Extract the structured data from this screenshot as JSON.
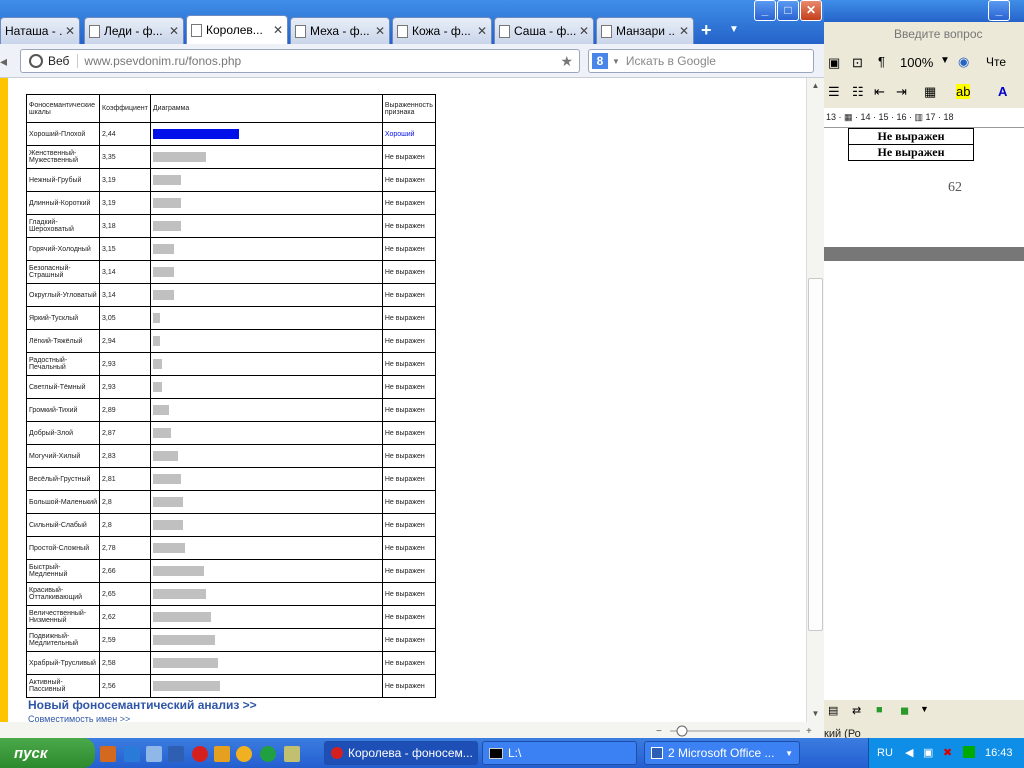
{
  "browser": {
    "tabs": [
      {
        "label": "Наташа - ..."
      },
      {
        "label": "Леди - ф..."
      },
      {
        "label": "Королев..."
      },
      {
        "label": "Меха - ф..."
      },
      {
        "label": "Кожа - ф..."
      },
      {
        "label": "Саша - ф..."
      },
      {
        "label": "Манзари ..."
      }
    ],
    "newtab": "+",
    "tab_close": "✕",
    "address": {
      "web_label": "Веб",
      "url": "www.psevdonim.ru/fonos.php"
    },
    "search": {
      "placeholder": "Искать в Google",
      "engine": "8"
    }
  },
  "table": {
    "headers": [
      "Фоносемантические шкалы",
      "Коэффициент",
      "Диаграмма",
      "Выраженность признака"
    ],
    "rows": [
      {
        "scale": "Хороший-Плохой",
        "coef": "2,44",
        "level": 0.37,
        "status": "Хороший",
        "highlight": true
      },
      {
        "scale": "Женственный-Мужественный",
        "coef": "3,35",
        "level": 0.23,
        "status": "Не выражен"
      },
      {
        "scale": "Нежный-Грубый",
        "coef": "3,19",
        "level": 0.12,
        "status": "Не выражен"
      },
      {
        "scale": "Длинный-Короткий",
        "coef": "3,19",
        "level": 0.12,
        "status": "Не выражен"
      },
      {
        "scale": "Гладкий-Шероховатый",
        "coef": "3,18",
        "level": 0.12,
        "status": "Не выражен"
      },
      {
        "scale": "Горячий-Холодный",
        "coef": "3,15",
        "level": 0.09,
        "status": "Не выражен"
      },
      {
        "scale": "Безопасный-Страшный",
        "coef": "3,14",
        "level": 0.09,
        "status": "Не выражен"
      },
      {
        "scale": "Округлый-Угловатый",
        "coef": "3,14",
        "level": 0.09,
        "status": "Не выражен"
      },
      {
        "scale": "Яркий-Тусклый",
        "coef": "3,05",
        "level": 0.03,
        "status": "Не выражен"
      },
      {
        "scale": "Лёгкий-Тяжёлый",
        "coef": "2,94",
        "level": 0.03,
        "status": "Не выражен"
      },
      {
        "scale": "Радостный-Печальный",
        "coef": "2,93",
        "level": 0.04,
        "status": "Не выражен"
      },
      {
        "scale": "Светлый-Тёмный",
        "coef": "2,93",
        "level": 0.04,
        "status": "Не выражен"
      },
      {
        "scale": "Громкий-Тихий",
        "coef": "2,89",
        "level": 0.07,
        "status": "Не выражен"
      },
      {
        "scale": "Добрый-Злой",
        "coef": "2,87",
        "level": 0.08,
        "status": "Не выражен"
      },
      {
        "scale": "Могучий-Хилый",
        "coef": "2,83",
        "level": 0.11,
        "status": "Не выражен"
      },
      {
        "scale": "Весёлый-Грустный",
        "coef": "2,81",
        "level": 0.12,
        "status": "Не выражен"
      },
      {
        "scale": "Большой-Маленький",
        "coef": "2,8",
        "level": 0.13,
        "status": "Не выражен"
      },
      {
        "scale": "Сильный-Слабый",
        "coef": "2,8",
        "level": 0.13,
        "status": "Не выражен"
      },
      {
        "scale": "Простой-Сложный",
        "coef": "2,78",
        "level": 0.14,
        "status": "Не выражен"
      },
      {
        "scale": "Быстрый-Медленный",
        "coef": "2,66",
        "level": 0.22,
        "status": "Не выражен"
      },
      {
        "scale": "Красивый-Отталкивающий",
        "coef": "2,65",
        "level": 0.23,
        "status": "Не выражен"
      },
      {
        "scale": "Величественный-Низменный",
        "coef": "2,62",
        "level": 0.25,
        "status": "Не выражен"
      },
      {
        "scale": "Подвижный-Медлительный",
        "coef": "2,59",
        "level": 0.27,
        "status": "Не выражен"
      },
      {
        "scale": "Храбрый-Трусливый",
        "coef": "2,58",
        "level": 0.28,
        "status": "Не выражен"
      },
      {
        "scale": "Активный-Пассивный",
        "coef": "2,56",
        "level": 0.29,
        "status": "Не выражен"
      }
    ],
    "bar_color": "#c0c0c0",
    "highlight_color": "#0010e8"
  },
  "links": {
    "new_analysis": "Новый фоносемантический анализ >>",
    "compatibility": "Совместимость имен >>"
  },
  "word": {
    "ask_placeholder": "Введите вопрос",
    "zoom": "100%",
    "toolbar_trailing_text": "Чте",
    "ruler": "13 · ▦ · 14 · 15 · 16 · ▥ 17 · 18",
    "table_cells": [
      "Не выражен",
      "Не выражен"
    ],
    "page_number": "62",
    "status_text": "кий (Ро"
  },
  "taskbar": {
    "start_label": "пуск",
    "buttons": [
      {
        "label": "Королева - фоносем..."
      },
      {
        "label": "L:\\"
      },
      {
        "label": "2 Microsoft Office ..."
      }
    ],
    "lang": "RU",
    "clock": "16:43"
  }
}
